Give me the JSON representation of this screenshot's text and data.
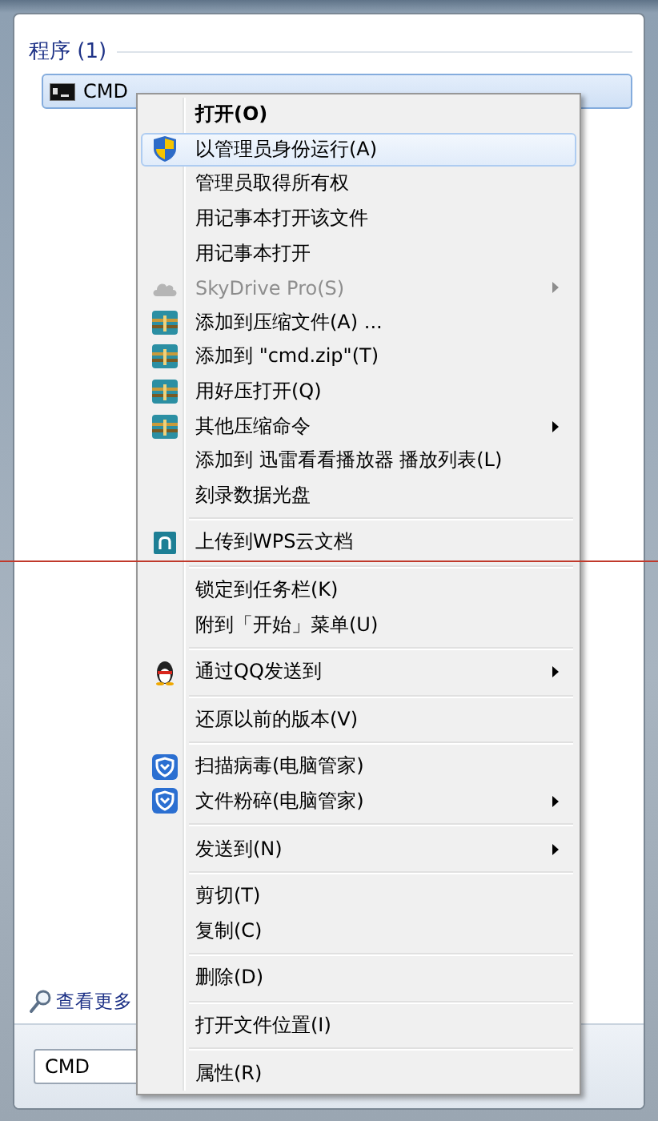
{
  "start_menu": {
    "section_heading": "程序 (1)",
    "results": [
      {
        "label": "CMD",
        "selected": true
      }
    ],
    "more_results_link": "查看更多",
    "search": {
      "value": "CMD"
    }
  },
  "context_menu": {
    "items": [
      {
        "kind": "command",
        "label": "打开(O)",
        "default": true,
        "selected": false,
        "disabled": false,
        "submenu": false
      },
      {
        "kind": "command",
        "label": "以管理员身份运行(A)",
        "default": false,
        "selected": true,
        "disabled": false,
        "submenu": false
      },
      {
        "kind": "command",
        "label": "管理员取得所有权",
        "default": false,
        "selected": false,
        "disabled": false,
        "submenu": false
      },
      {
        "kind": "command",
        "label": "用记事本打开该文件",
        "default": false,
        "selected": false,
        "disabled": false,
        "submenu": false
      },
      {
        "kind": "command",
        "label": "用记事本打开",
        "default": false,
        "selected": false,
        "disabled": false,
        "submenu": false
      },
      {
        "kind": "command",
        "label": "SkyDrive Pro(S)",
        "default": false,
        "selected": false,
        "disabled": true,
        "submenu": true
      },
      {
        "kind": "command",
        "label": "添加到压缩文件(A) ...",
        "default": false,
        "selected": false,
        "disabled": false,
        "submenu": false
      },
      {
        "kind": "command",
        "label": "添加到 \"cmd.zip\"(T)",
        "default": false,
        "selected": false,
        "disabled": false,
        "submenu": false
      },
      {
        "kind": "command",
        "label": "用好压打开(Q)",
        "default": false,
        "selected": false,
        "disabled": false,
        "submenu": false
      },
      {
        "kind": "command",
        "label": "其他压缩命令",
        "default": false,
        "selected": false,
        "disabled": false,
        "submenu": true
      },
      {
        "kind": "command",
        "label": "添加到 迅雷看看播放器 播放列表(L)",
        "default": false,
        "selected": false,
        "disabled": false,
        "submenu": false
      },
      {
        "kind": "command",
        "label": "刻录数据光盘",
        "default": false,
        "selected": false,
        "disabled": false,
        "submenu": false
      },
      {
        "kind": "separator"
      },
      {
        "kind": "command",
        "label": "上传到WPS云文档",
        "default": false,
        "selected": false,
        "disabled": false,
        "submenu": false
      },
      {
        "kind": "separator"
      },
      {
        "kind": "command",
        "label": "锁定到任务栏(K)",
        "default": false,
        "selected": false,
        "disabled": false,
        "submenu": false
      },
      {
        "kind": "command",
        "label": "附到「开始」菜单(U)",
        "default": false,
        "selected": false,
        "disabled": false,
        "submenu": false
      },
      {
        "kind": "separator"
      },
      {
        "kind": "command",
        "label": "通过QQ发送到",
        "default": false,
        "selected": false,
        "disabled": false,
        "submenu": true
      },
      {
        "kind": "separator"
      },
      {
        "kind": "command",
        "label": "还原以前的版本(V)",
        "default": false,
        "selected": false,
        "disabled": false,
        "submenu": false
      },
      {
        "kind": "separator"
      },
      {
        "kind": "command",
        "label": "扫描病毒(电脑管家)",
        "default": false,
        "selected": false,
        "disabled": false,
        "submenu": false
      },
      {
        "kind": "command",
        "label": "文件粉碎(电脑管家)",
        "default": false,
        "selected": false,
        "disabled": false,
        "submenu": true
      },
      {
        "kind": "separator"
      },
      {
        "kind": "command",
        "label": "发送到(N)",
        "default": false,
        "selected": false,
        "disabled": false,
        "submenu": true
      },
      {
        "kind": "separator"
      },
      {
        "kind": "command",
        "label": "剪切(T)",
        "default": false,
        "selected": false,
        "disabled": false,
        "submenu": false
      },
      {
        "kind": "command",
        "label": "复制(C)",
        "default": false,
        "selected": false,
        "disabled": false,
        "submenu": false
      },
      {
        "kind": "separator"
      },
      {
        "kind": "command",
        "label": "删除(D)",
        "default": false,
        "selected": false,
        "disabled": false,
        "submenu": false
      },
      {
        "kind": "separator"
      },
      {
        "kind": "command",
        "label": "打开文件位置(I)",
        "default": false,
        "selected": false,
        "disabled": false,
        "submenu": false
      },
      {
        "kind": "separator"
      },
      {
        "kind": "command",
        "label": "属性(R)",
        "default": false,
        "selected": false,
        "disabled": false,
        "submenu": false
      }
    ]
  }
}
